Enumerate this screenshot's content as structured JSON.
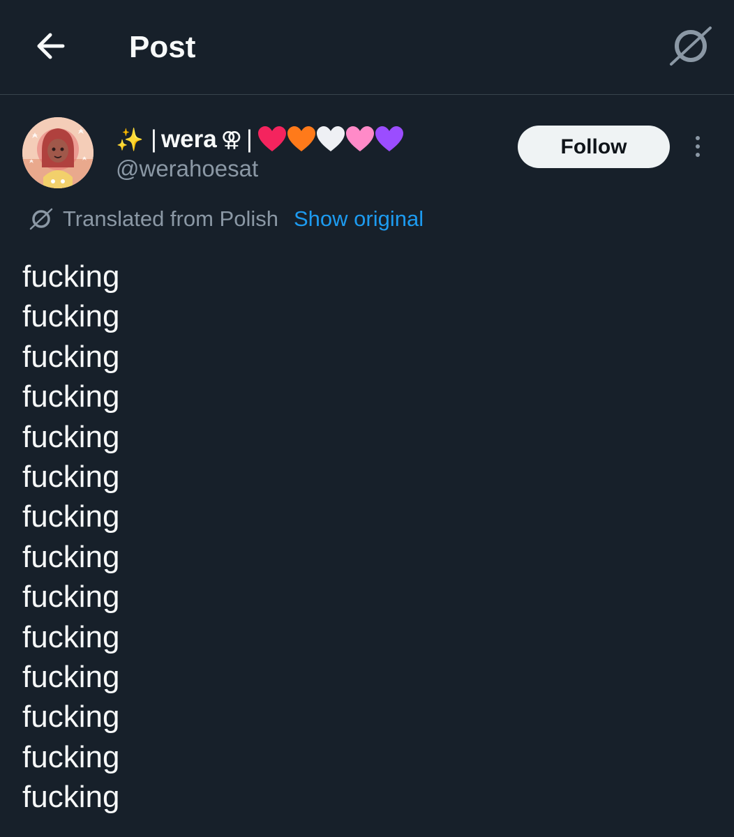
{
  "header": {
    "title": "Post",
    "back_icon": "arrow-left-icon",
    "translate_icon": "translate-icon"
  },
  "author": {
    "name_prefix": "✨",
    "separator": "|",
    "name": "wera",
    "venus_symbol": "⚢",
    "hearts": [
      "red-heart",
      "orange-heart",
      "white-heart",
      "pink-heart",
      "purple-heart"
    ],
    "handle": "@werahoesat"
  },
  "follow_label": "Follow",
  "translation": {
    "label": "Translated from Polish",
    "show_original": "Show original"
  },
  "post_lines": [
    "fucking",
    "fucking",
    "fucking",
    "fucking",
    "fucking",
    "fucking",
    "fucking",
    "fucking",
    "fucking",
    "fucking",
    "fucking",
    "fucking",
    "fucking",
    "fucking"
  ],
  "colors": {
    "background": "#17202a",
    "text": "#f7f9f9",
    "muted": "#8b98a5",
    "link": "#1d9bf0",
    "divider": "#38444d",
    "follow_bg": "#eff3f4"
  }
}
